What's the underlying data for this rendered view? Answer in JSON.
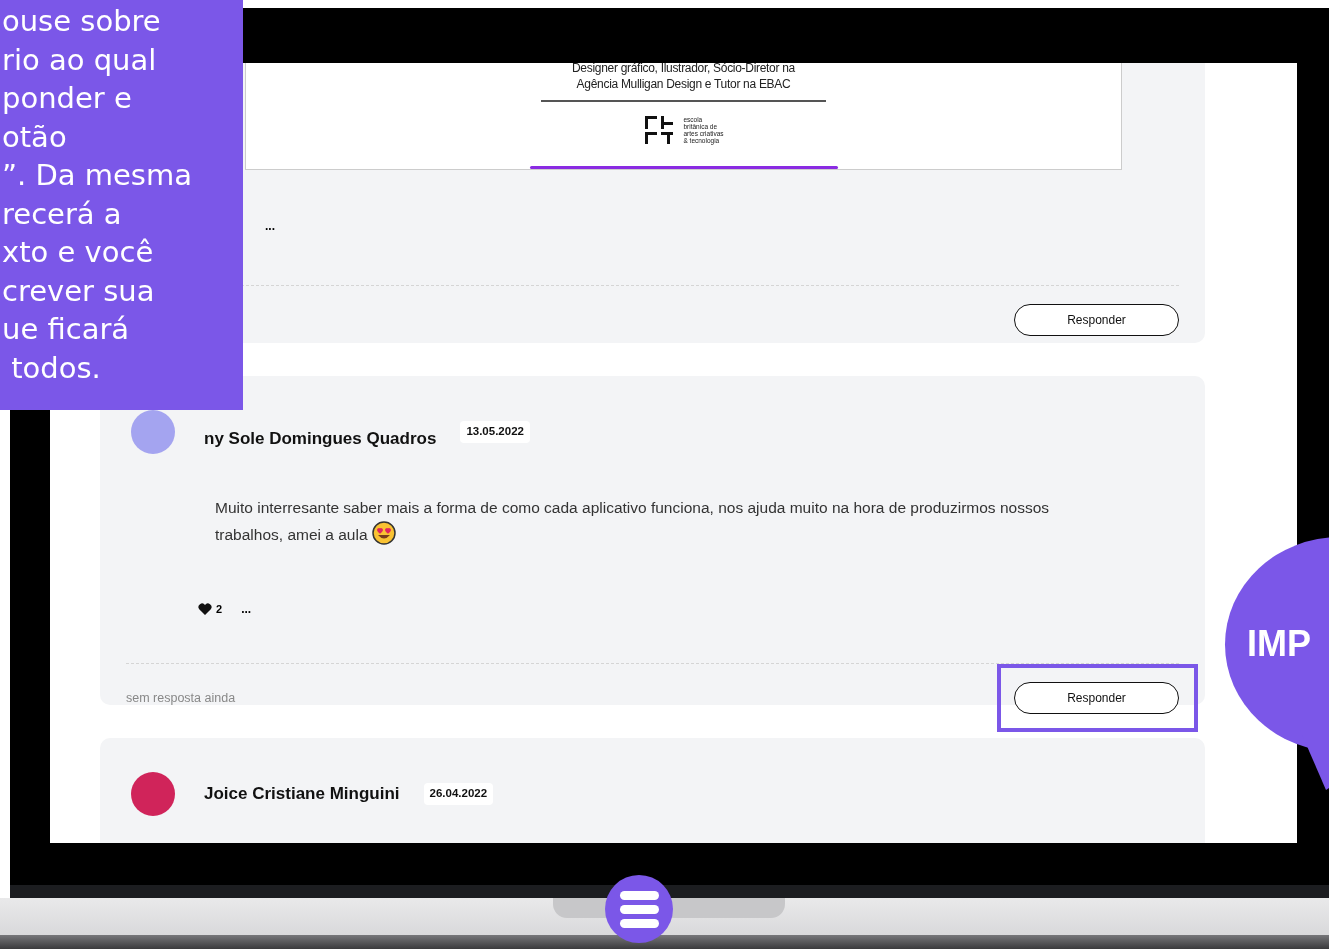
{
  "instruction_panel": {
    "lines": [
      "ouse sobre",
      "rio ao qual",
      "ponder e",
      "otão",
      "”. Da mesma",
      "recerá a",
      "xto e você",
      "crever sua",
      "ue ficará",
      " todos."
    ]
  },
  "attachment": {
    "caption_lines": [
      "Designer gráfico, Ilustrador, Sócio-Diretor na",
      "Agência Mulligan Design e Tutor na EBAC"
    ],
    "logo_lines": [
      "escola",
      "britânica de",
      "artes criativas",
      "& tecnologia"
    ]
  },
  "comments": [
    {
      "more": "...",
      "reply_button": "Responder",
      "highlighted": false
    },
    {
      "author": "ny Sole Domingues Quadros",
      "date": "13.05.2022",
      "text": "Muito interresante saber mais a forma de como cada aplicativo funciona, nos ajuda muito na hora de produzirmos nossos trabalhos, amei a aula",
      "likes": "2",
      "more": "...",
      "reply_status": "sem resposta ainda",
      "reply_button": "Responder",
      "highlighted": true
    },
    {
      "author": "Joice Cristiane Minguini",
      "date": "26.04.2022"
    }
  ],
  "callout": {
    "text": "IMP"
  }
}
